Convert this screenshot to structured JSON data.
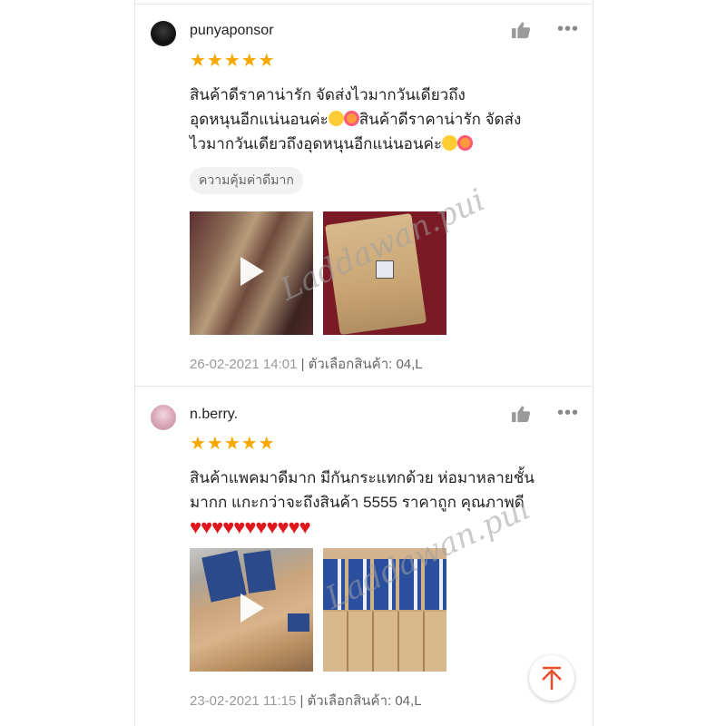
{
  "reviews": [
    {
      "username": "punyaponsor",
      "rating": 5,
      "stars": "★★★★★",
      "text_line1": "สินค้าดีราคาน่ารัก จัดส่งไวมากวันเดียวถึง",
      "text_line2": "อุดหนุนอีกแน่นอนค่ะ",
      "text_line2b": "สินค้าดีราคาน่ารัก จัดส่ง",
      "text_line3": "ไวมากวันเดียวถึงอุดหนุนอีกแน่นอนค่ะ",
      "tag": "ความคุ้มค่าดีมาก",
      "date": "26-02-2021 14:01",
      "option": "| ตัวเลือกสินค้า: 04,L"
    },
    {
      "username": "n.berry.",
      "rating": 5,
      "stars": "★★★★★",
      "text_line1": "สินค้าแพคมาดีมาก มีกันกระแทกด้วย ห่อมาหลายชั้น",
      "text_line2": "มากก แกะกว่าจะถึงสินค้า 5555 ราคาถูก คุณภาพดี",
      "hearts": "♥♥♥♥♥♥♥♥♥♥♥",
      "date": "23-02-2021 11:15",
      "option": "| ตัวเลือกสินค้า: 04,L"
    }
  ],
  "watermark": "Laddawan.pui",
  "icons": {
    "like": "thumbs-up-icon",
    "more": "more-dots-icon",
    "play": "play-icon",
    "scroll_top": "arrow-up-icon"
  },
  "colors": {
    "star": "#f6a700",
    "heart": "#e0171c",
    "scroll_top_arrow": "#ee4d2d"
  }
}
